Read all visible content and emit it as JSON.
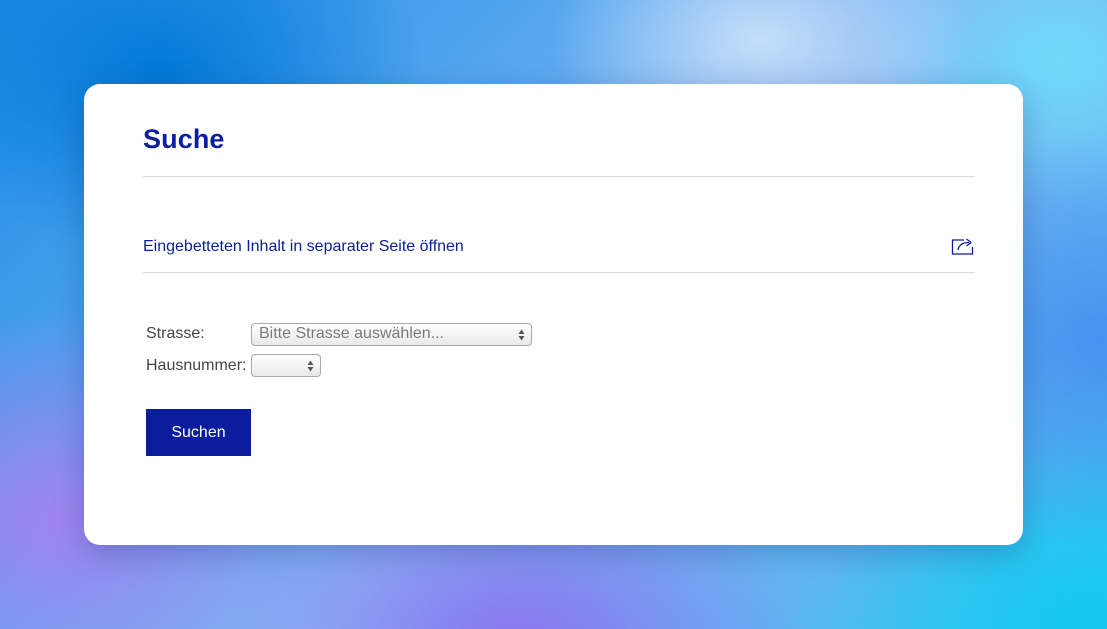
{
  "card": {
    "title": "Suche",
    "embed_link": {
      "label": "Eingebetteten Inhalt in separater Seite öffnen",
      "icon": "external-share-icon"
    }
  },
  "form": {
    "street": {
      "label": "Strasse:",
      "placeholder": "Bitte Strasse auswählen..."
    },
    "house_number": {
      "label": "Hausnummer:",
      "value": ""
    },
    "submit_label": "Suchen"
  },
  "colors": {
    "primary": "#0b1f9c",
    "divider": "#dcdcdc",
    "card_background": "#ffffff"
  }
}
